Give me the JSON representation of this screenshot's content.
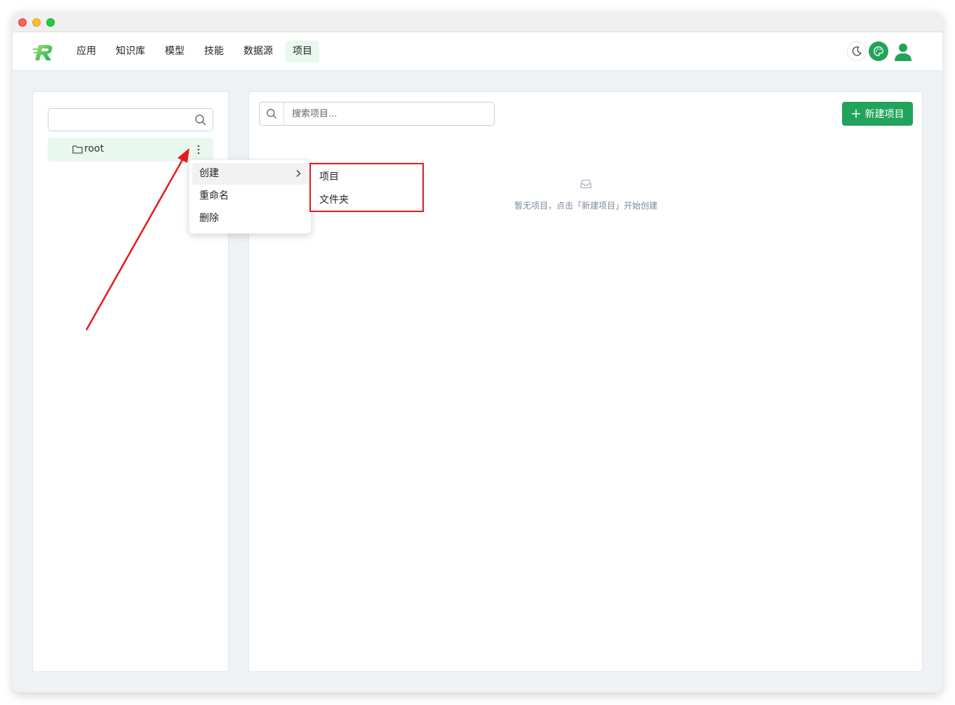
{
  "nav": {
    "items": [
      {
        "label": "应用"
      },
      {
        "label": "知识库"
      },
      {
        "label": "模型"
      },
      {
        "label": "技能"
      },
      {
        "label": "数据源"
      },
      {
        "label": "项目",
        "active": true
      }
    ],
    "icons": {
      "theme": "moon-icon",
      "palette": "palette-icon",
      "user": "user-icon"
    },
    "accent_color": "#22a35a"
  },
  "tree": {
    "search_value": "",
    "root_label": "root"
  },
  "context_menu": {
    "items": [
      {
        "label": "创建",
        "has_submenu": true
      },
      {
        "label": "重命名"
      },
      {
        "label": "删除"
      }
    ],
    "submenu_items": [
      {
        "label": "项目"
      },
      {
        "label": "文件夹"
      }
    ]
  },
  "main": {
    "search_placeholder": "搜索项目...",
    "new_button_label": "新建项目",
    "empty_text": "暂无项目，点击「新建项目」开始创建"
  }
}
